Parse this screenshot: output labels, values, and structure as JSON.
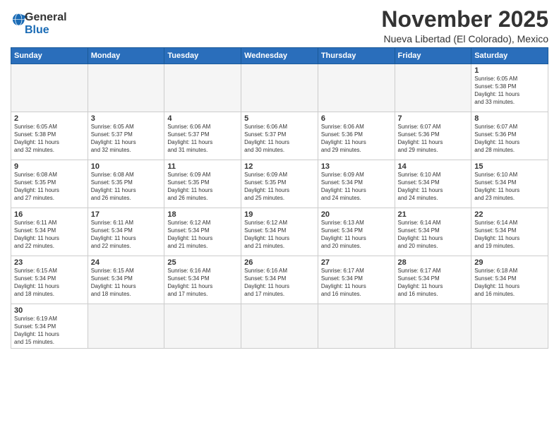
{
  "header": {
    "logo_general": "General",
    "logo_blue": "Blue",
    "month_title": "November 2025",
    "subtitle": "Nueva Libertad (El Colorado), Mexico"
  },
  "weekdays": [
    "Sunday",
    "Monday",
    "Tuesday",
    "Wednesday",
    "Thursday",
    "Friday",
    "Saturday"
  ],
  "weeks": [
    [
      {
        "day": "",
        "info": ""
      },
      {
        "day": "",
        "info": ""
      },
      {
        "day": "",
        "info": ""
      },
      {
        "day": "",
        "info": ""
      },
      {
        "day": "",
        "info": ""
      },
      {
        "day": "",
        "info": ""
      },
      {
        "day": "1",
        "info": "Sunrise: 6:05 AM\nSunset: 5:38 PM\nDaylight: 11 hours\nand 33 minutes."
      }
    ],
    [
      {
        "day": "2",
        "info": "Sunrise: 6:05 AM\nSunset: 5:38 PM\nDaylight: 11 hours\nand 32 minutes."
      },
      {
        "day": "3",
        "info": "Sunrise: 6:05 AM\nSunset: 5:37 PM\nDaylight: 11 hours\nand 32 minutes."
      },
      {
        "day": "4",
        "info": "Sunrise: 6:06 AM\nSunset: 5:37 PM\nDaylight: 11 hours\nand 31 minutes."
      },
      {
        "day": "5",
        "info": "Sunrise: 6:06 AM\nSunset: 5:37 PM\nDaylight: 11 hours\nand 30 minutes."
      },
      {
        "day": "6",
        "info": "Sunrise: 6:06 AM\nSunset: 5:36 PM\nDaylight: 11 hours\nand 29 minutes."
      },
      {
        "day": "7",
        "info": "Sunrise: 6:07 AM\nSunset: 5:36 PM\nDaylight: 11 hours\nand 29 minutes."
      },
      {
        "day": "8",
        "info": "Sunrise: 6:07 AM\nSunset: 5:36 PM\nDaylight: 11 hours\nand 28 minutes."
      }
    ],
    [
      {
        "day": "9",
        "info": "Sunrise: 6:08 AM\nSunset: 5:35 PM\nDaylight: 11 hours\nand 27 minutes."
      },
      {
        "day": "10",
        "info": "Sunrise: 6:08 AM\nSunset: 5:35 PM\nDaylight: 11 hours\nand 26 minutes."
      },
      {
        "day": "11",
        "info": "Sunrise: 6:09 AM\nSunset: 5:35 PM\nDaylight: 11 hours\nand 26 minutes."
      },
      {
        "day": "12",
        "info": "Sunrise: 6:09 AM\nSunset: 5:35 PM\nDaylight: 11 hours\nand 25 minutes."
      },
      {
        "day": "13",
        "info": "Sunrise: 6:09 AM\nSunset: 5:34 PM\nDaylight: 11 hours\nand 24 minutes."
      },
      {
        "day": "14",
        "info": "Sunrise: 6:10 AM\nSunset: 5:34 PM\nDaylight: 11 hours\nand 24 minutes."
      },
      {
        "day": "15",
        "info": "Sunrise: 6:10 AM\nSunset: 5:34 PM\nDaylight: 11 hours\nand 23 minutes."
      }
    ],
    [
      {
        "day": "16",
        "info": "Sunrise: 6:11 AM\nSunset: 5:34 PM\nDaylight: 11 hours\nand 22 minutes."
      },
      {
        "day": "17",
        "info": "Sunrise: 6:11 AM\nSunset: 5:34 PM\nDaylight: 11 hours\nand 22 minutes."
      },
      {
        "day": "18",
        "info": "Sunrise: 6:12 AM\nSunset: 5:34 PM\nDaylight: 11 hours\nand 21 minutes."
      },
      {
        "day": "19",
        "info": "Sunrise: 6:12 AM\nSunset: 5:34 PM\nDaylight: 11 hours\nand 21 minutes."
      },
      {
        "day": "20",
        "info": "Sunrise: 6:13 AM\nSunset: 5:34 PM\nDaylight: 11 hours\nand 20 minutes."
      },
      {
        "day": "21",
        "info": "Sunrise: 6:14 AM\nSunset: 5:34 PM\nDaylight: 11 hours\nand 20 minutes."
      },
      {
        "day": "22",
        "info": "Sunrise: 6:14 AM\nSunset: 5:34 PM\nDaylight: 11 hours\nand 19 minutes."
      }
    ],
    [
      {
        "day": "23",
        "info": "Sunrise: 6:15 AM\nSunset: 5:34 PM\nDaylight: 11 hours\nand 18 minutes."
      },
      {
        "day": "24",
        "info": "Sunrise: 6:15 AM\nSunset: 5:34 PM\nDaylight: 11 hours\nand 18 minutes."
      },
      {
        "day": "25",
        "info": "Sunrise: 6:16 AM\nSunset: 5:34 PM\nDaylight: 11 hours\nand 17 minutes."
      },
      {
        "day": "26",
        "info": "Sunrise: 6:16 AM\nSunset: 5:34 PM\nDaylight: 11 hours\nand 17 minutes."
      },
      {
        "day": "27",
        "info": "Sunrise: 6:17 AM\nSunset: 5:34 PM\nDaylight: 11 hours\nand 16 minutes."
      },
      {
        "day": "28",
        "info": "Sunrise: 6:17 AM\nSunset: 5:34 PM\nDaylight: 11 hours\nand 16 minutes."
      },
      {
        "day": "29",
        "info": "Sunrise: 6:18 AM\nSunset: 5:34 PM\nDaylight: 11 hours\nand 16 minutes."
      }
    ],
    [
      {
        "day": "30",
        "info": "Sunrise: 6:19 AM\nSunset: 5:34 PM\nDaylight: 11 hours\nand 15 minutes."
      },
      {
        "day": "",
        "info": ""
      },
      {
        "day": "",
        "info": ""
      },
      {
        "day": "",
        "info": ""
      },
      {
        "day": "",
        "info": ""
      },
      {
        "day": "",
        "info": ""
      },
      {
        "day": "",
        "info": ""
      }
    ]
  ]
}
